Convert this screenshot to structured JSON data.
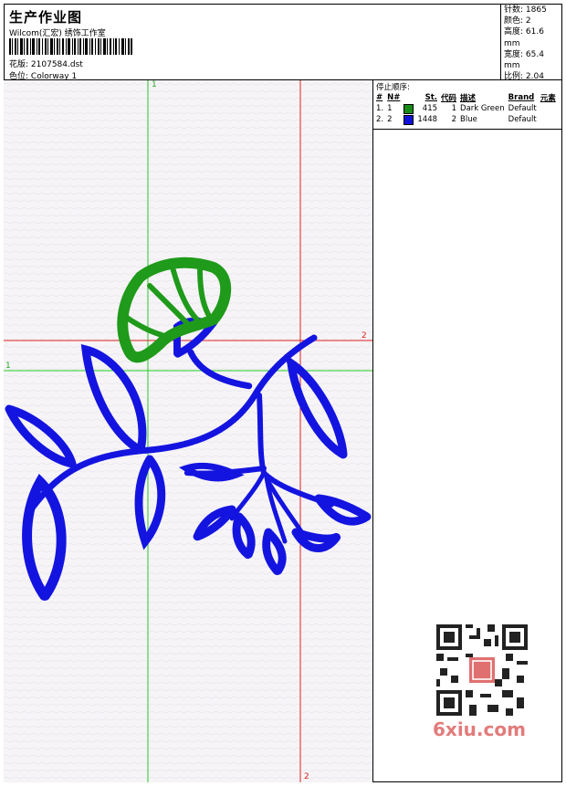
{
  "header": {
    "title": "生产作业图",
    "company": "Wilcom(汇宏) 绣饰工作室",
    "design_label": "花版:",
    "design_value": "2107584.dst",
    "colorway_label": "色位:",
    "colorway_value": "Colorway 1"
  },
  "stats": [
    {
      "label": "针数:",
      "value": "1865"
    },
    {
      "label": "颜色:",
      "value": "2"
    },
    {
      "label": "高度:",
      "value": "61.6 mm"
    },
    {
      "label": "宽度:",
      "value": "65.4 mm"
    },
    {
      "label": "比例:",
      "value": "2.04"
    }
  ],
  "stop_sequence": {
    "title": "停止顺序:",
    "headers": [
      "#",
      "N#",
      "St.",
      "代码",
      "描述",
      "Brand",
      "元素"
    ],
    "rows": [
      {
        "idx": "1.",
        "n": "1",
        "color": "#178a17",
        "stitches": "415",
        "code": "1",
        "desc": "Dark Green",
        "brand": "Default"
      },
      {
        "idx": "2.",
        "n": "2",
        "color": "#1010d8",
        "stitches": "1448",
        "code": "2",
        "desc": "Blue",
        "brand": "Default"
      }
    ]
  },
  "guides": {
    "green_label": "1",
    "red_label": "2"
  },
  "colors": {
    "green_thread": "#1f9a1a",
    "blue_thread": "#1414e0",
    "guide_green": "#22cc22",
    "guide_red": "#dd2222"
  },
  "watermark": {
    "text": "6xiu.com"
  }
}
